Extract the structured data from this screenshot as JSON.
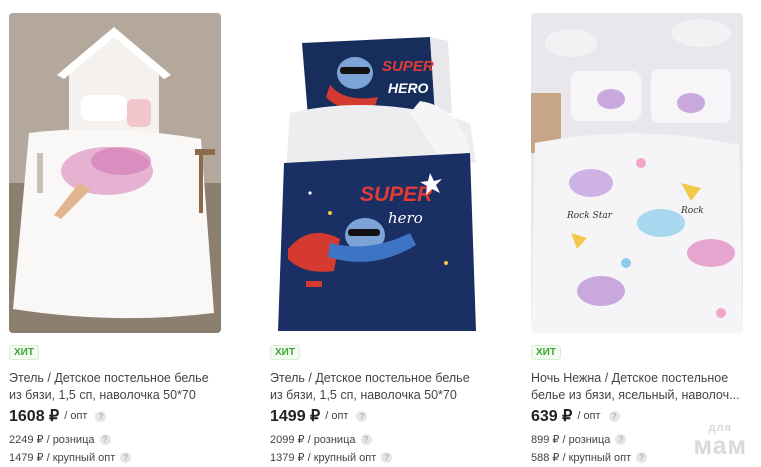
{
  "products": [
    {
      "badge": "ХИТ",
      "title_line1": "Этель / Детское постельное белье",
      "title_line2": "из бязи, 1,5 сп, наволочка 50*70",
      "price": "1608 ₽",
      "price_note": "/ опт",
      "retail": "2249 ₽ / розница",
      "wholesale": "1479 ₽ / крупный опт",
      "image": "bed-ballerina-image"
    },
    {
      "badge": "ХИТ",
      "title_line1": "Этель / Детское постельное белье",
      "title_line2": "из бязи, 1,5 сп, наволочка 50*70",
      "price": "1499 ₽",
      "price_note": "/ опт",
      "retail": "2099 ₽ / розница",
      "wholesale": "1379 ₽ / крупный опт",
      "image": "superhero-bedding-image",
      "print_text_1": "SUPER",
      "print_text_2": "HERO",
      "print_text_3": "SUPER",
      "print_text_4": "hero"
    },
    {
      "badge": "ХИТ",
      "title_line1": "Ночь Нежна / Детское постельное",
      "title_line2": "белье из бязи, ясельный, наволоч...",
      "price": "639 ₽",
      "price_note": "/ опт",
      "retail": "899 ₽ / розница",
      "wholesale": "588 ₽ / крупный опт",
      "image": "unicorn-bedding-image",
      "print_text_1": "Rock Star",
      "print_text_2": "Rock"
    }
  ],
  "help_icon": "?",
  "watermark_top": "для",
  "watermark_bottom": "мам"
}
